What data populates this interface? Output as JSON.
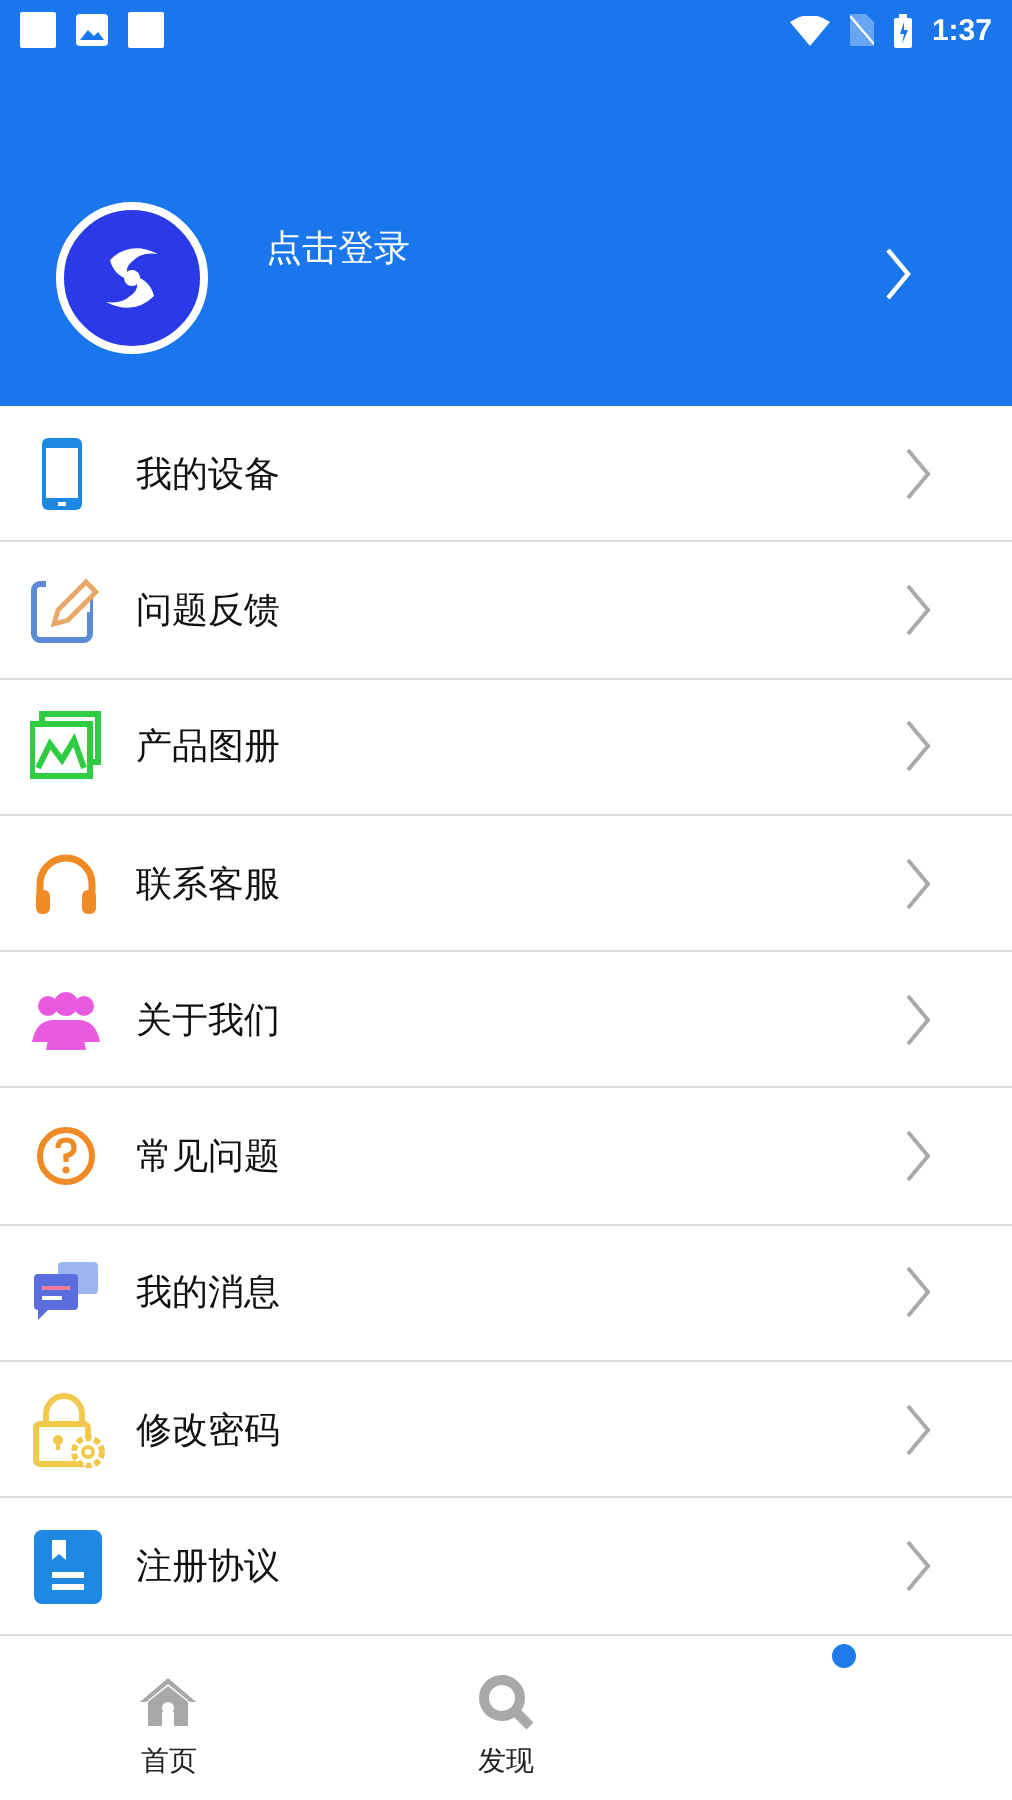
{
  "status_bar": {
    "time": "1:37"
  },
  "header": {
    "login_label": "点击登录"
  },
  "menu": [
    {
      "label": "我的设备"
    },
    {
      "label": "问题反馈"
    },
    {
      "label": "产品图册"
    },
    {
      "label": "联系客服"
    },
    {
      "label": "关于我们"
    },
    {
      "label": "常见问题"
    },
    {
      "label": "我的消息"
    },
    {
      "label": "修改密码"
    },
    {
      "label": "注册协议"
    }
  ],
  "tabs": [
    {
      "label": "首页",
      "selected": false
    },
    {
      "label": "发现",
      "selected": false
    },
    {
      "selected": true
    }
  ]
}
